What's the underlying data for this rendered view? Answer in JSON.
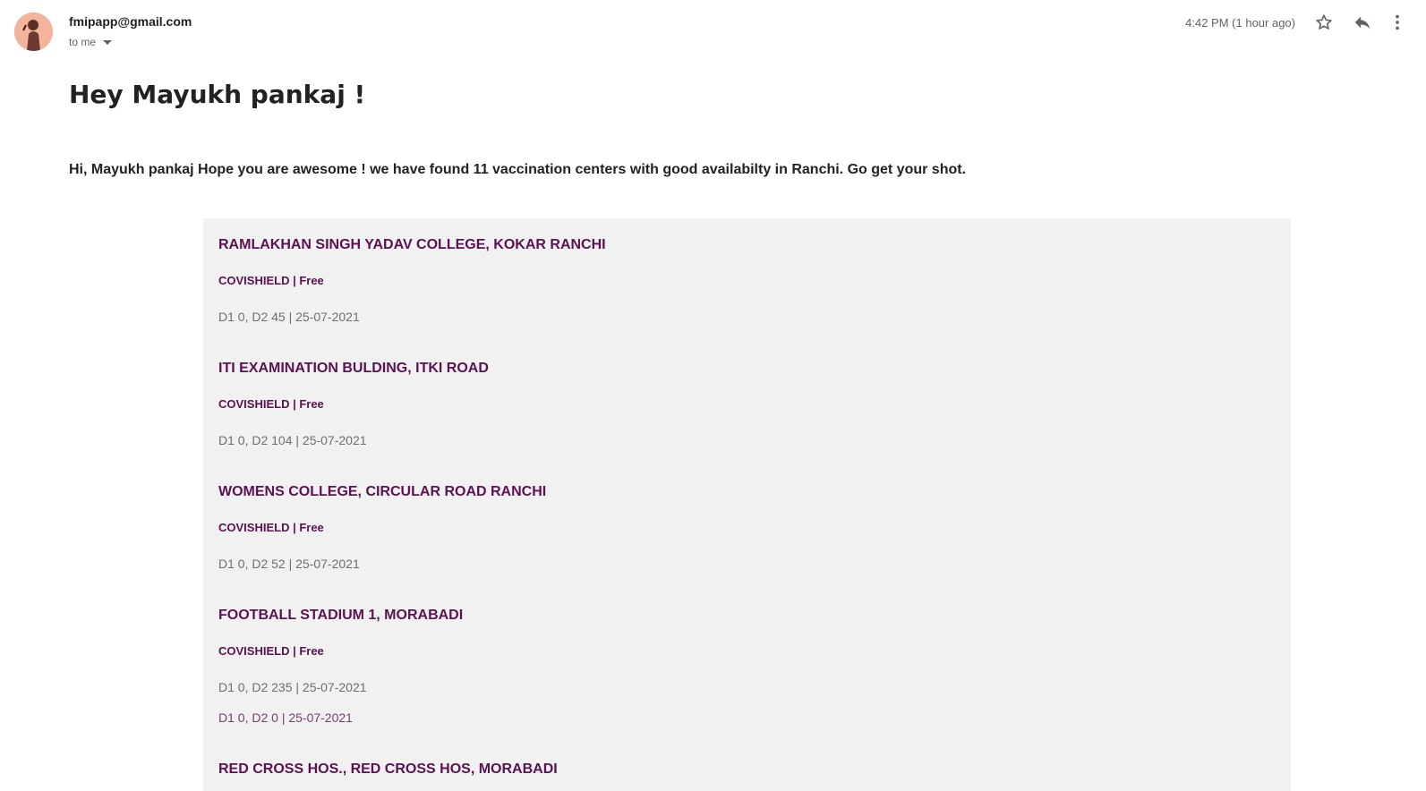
{
  "email": {
    "from": "fmipapp@gmail.com",
    "to": "to me",
    "time": "4:42 PM (1 hour ago)"
  },
  "icons": {
    "star": "star-icon",
    "reply": "reply-icon",
    "more": "more-vert-icon",
    "caret": "caret-down-icon"
  },
  "message": {
    "greeting": "Hey Mayukh pankaj !",
    "intro": "Hi, Mayukh pankaj Hope you are awesome ! we have found 11 vaccination centers with good availabilty in Ranchi. Go get your shot."
  },
  "centers": [
    {
      "name": "RAMLAKHAN SINGH YADAV COLLEGE, KOKAR RANCHI",
      "vaccine": "COVISHIELD | Free",
      "doses": [
        "D1 0, D2 45 | 25-07-2021"
      ]
    },
    {
      "name": "ITI EXAMINATION BULDING, ITKI ROAD",
      "vaccine": "COVISHIELD | Free",
      "doses": [
        "D1 0, D2 104 | 25-07-2021"
      ]
    },
    {
      "name": "WOMENS COLLEGE, CIRCULAR ROAD RANCHI",
      "vaccine": "COVISHIELD | Free",
      "doses": [
        "D1 0, D2 52 | 25-07-2021"
      ]
    },
    {
      "name": "FOOTBALL STADIUM 1, MORABADI",
      "vaccine": "COVISHIELD | Free",
      "doses": [
        "D1 0, D2 235 | 25-07-2021",
        "D1 0, D2 0 | 25-07-2021"
      ]
    },
    {
      "name": "RED CROSS HOS., RED CROSS HOS, MORABADI",
      "vaccine": "",
      "doses": []
    }
  ],
  "colors": {
    "accent": "#5b1152",
    "panel": "#f1f1f2"
  }
}
